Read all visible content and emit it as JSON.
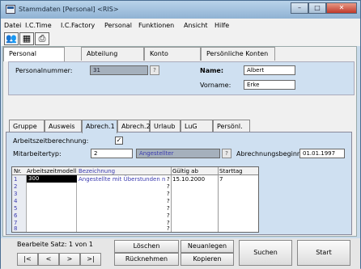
{
  "window": {
    "title": "Stammdaten [Personal] <RIS>",
    "minimize": "–",
    "maximize": "□",
    "close": "✕"
  },
  "menu": [
    "Datei",
    "I.C.Time",
    "I.C.Factory",
    "Personal",
    "Funktionen",
    "Ansicht",
    "Hilfe"
  ],
  "tabs": [
    "Personal",
    "Abteilung",
    "Konto",
    "Persönliche Konten"
  ],
  "header": {
    "personalnummer_label": "Personalnummer:",
    "personalnummer_value": "31",
    "name_label": "Name:",
    "name_value": "Albert",
    "vorname_label": "Vorname:",
    "vorname_value": "Erke",
    "question": "?"
  },
  "subtabs": [
    "Gruppe",
    "Ausweis",
    "Abrech.1",
    "Abrech.2",
    "Urlaub",
    "LuG",
    "Persönl."
  ],
  "abrech": {
    "arbeitszeitberechnung_label": "Arbeitszeitberechnung:",
    "arbeitszeitberechnung_checked": "✓",
    "mitarbeitertyp_label": "Mitarbeitertyp:",
    "mitarbeitertyp_value": "2",
    "mitarbeitertyp_desc": "Angestellter",
    "question": "?",
    "abrechnungsbeginn_label": "Abrechnungsbeginn:",
    "abrechnungsbeginn_value": "01.01.1997"
  },
  "grid": {
    "headers": [
      "Nr.",
      "Arbeitszeitmodell",
      "Bezeichnung",
      "Gültig ab",
      "Starttag"
    ],
    "rows": [
      "1",
      "2",
      "3",
      "4",
      "5",
      "6",
      "7",
      "8"
    ],
    "first_row": {
      "model": "300",
      "bezeichnung": "Angestellte mit Überstunden n",
      "q": "?",
      "gueltig": "15.10.2000",
      "starttag": "7"
    },
    "q": "?"
  },
  "bottom": {
    "status": "Bearbeite Satz: 1 von 1",
    "first": "|<",
    "prev": "<",
    "next": ">",
    "last": ">|",
    "loeschen": "Löschen",
    "ruecknehmen": "Rücknehmen",
    "neuanlegen": "Neuanlegen",
    "kopieren": "Kopieren",
    "suchen": "Suchen",
    "start": "Start"
  },
  "colors": {
    "accent": "#cfe0f1",
    "title": "#8fb2d3"
  }
}
